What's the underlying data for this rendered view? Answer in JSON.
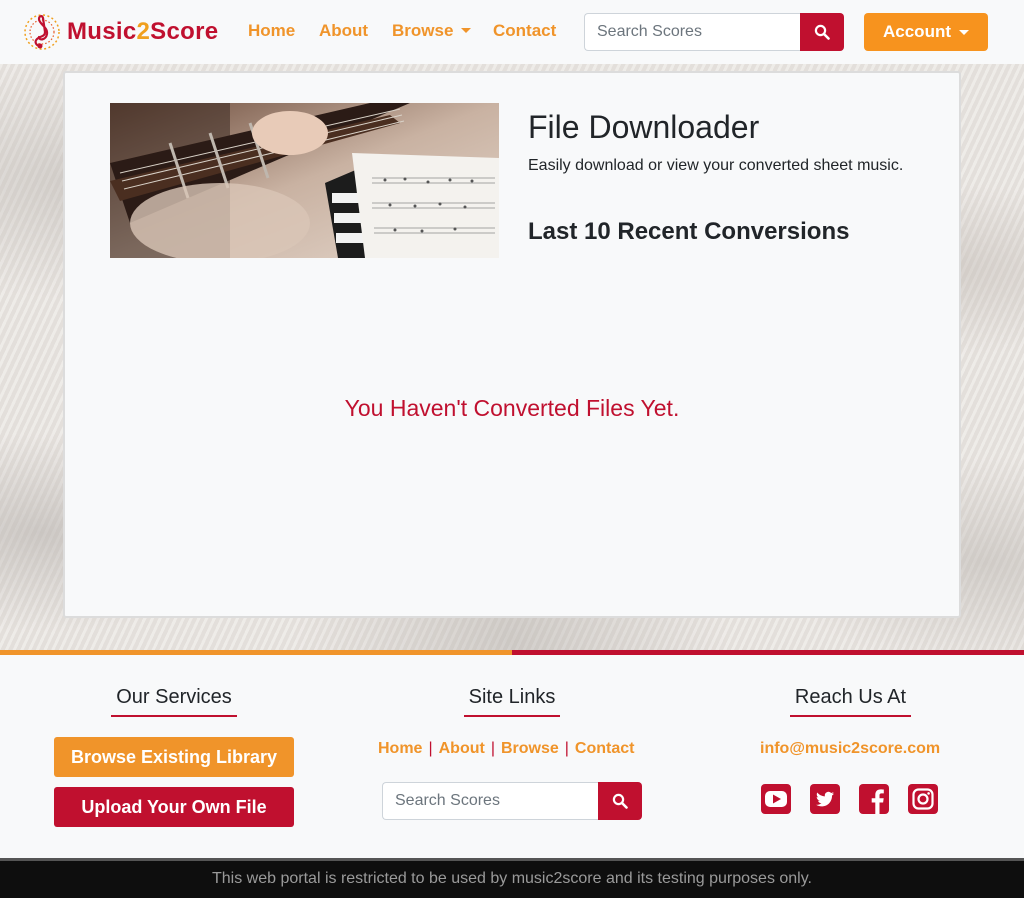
{
  "brand": {
    "part1": "Music",
    "part2": "2",
    "part3": "Score"
  },
  "nav": {
    "home": "Home",
    "about": "About",
    "browse": "Browse",
    "contact": "Contact",
    "search_placeholder": "Search Scores",
    "account": "Account"
  },
  "main": {
    "title": "File Downloader",
    "description": "Easily download or view your converted sheet music.",
    "subtitle": "Last 10 Recent Conversions",
    "empty_message": "You Haven't Converted Files Yet."
  },
  "footer": {
    "services_heading": "Our Services",
    "browse_library": "Browse Existing Library",
    "upload_file": "Upload Your Own File",
    "links_heading": "Site Links",
    "links": [
      "Home",
      "About",
      "Browse",
      "Contact"
    ],
    "search_placeholder": "Search Scores",
    "reach_heading": "Reach Us At",
    "email": "info@music2score.com",
    "social_icons": [
      "youtube-icon",
      "twitter-icon",
      "facebook-icon",
      "instagram-icon"
    ],
    "notice": "This web portal is restricted to be used by music2score and its testing purposes only."
  },
  "colors": {
    "accent_orange": "#f0942a",
    "accent_red": "#c0102f",
    "background": "#f8f9fa"
  }
}
